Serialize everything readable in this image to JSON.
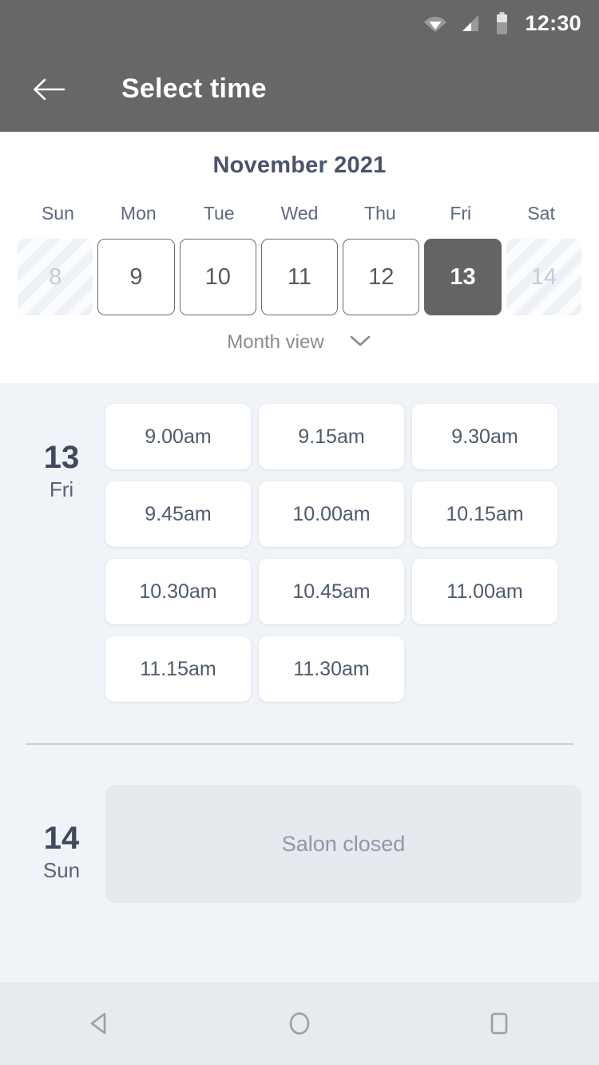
{
  "statusbar": {
    "time": "12:30",
    "icons": [
      "wifi-icon",
      "signal-icon",
      "battery-icon"
    ]
  },
  "appbar": {
    "title": "Select time",
    "back_icon": "arrow-left-icon"
  },
  "calendar": {
    "month_title": "November 2021",
    "weekday_headers": [
      "Sun",
      "Mon",
      "Tue",
      "Wed",
      "Thu",
      "Fri",
      "Sat"
    ],
    "days": [
      {
        "num": "8",
        "state": "disabled"
      },
      {
        "num": "9",
        "state": "available"
      },
      {
        "num": "10",
        "state": "available"
      },
      {
        "num": "11",
        "state": "available"
      },
      {
        "num": "12",
        "state": "available"
      },
      {
        "num": "13",
        "state": "selected"
      },
      {
        "num": "14",
        "state": "disabled"
      }
    ],
    "view_switch_label": "Month view",
    "view_switch_icon": "chevron-down-icon"
  },
  "slots_section": {
    "day": {
      "number": "13",
      "weekday": "Fri",
      "times": [
        "9.00am",
        "9.15am",
        "9.30am",
        "9.45am",
        "10.00am",
        "10.15am",
        "10.30am",
        "10.45am",
        "11.00am",
        "11.15am",
        "11.30am"
      ]
    },
    "closed_day": {
      "number": "14",
      "weekday": "Sun",
      "message": "Salon closed"
    }
  },
  "navbar": {
    "back_icon": "nav-back-triangle-icon",
    "home_icon": "nav-home-circle-icon",
    "recents_icon": "nav-recents-square-icon"
  },
  "colors": {
    "appbar_bg": "#676767",
    "selected_day_bg": "#646464",
    "slots_bg": "#f0f3f8",
    "slot_chip_bg": "#ffffff",
    "text_slate": "#49546b",
    "closed_panel_bg": "#e6e9ee",
    "navbar_bg": "#e7eaee"
  }
}
